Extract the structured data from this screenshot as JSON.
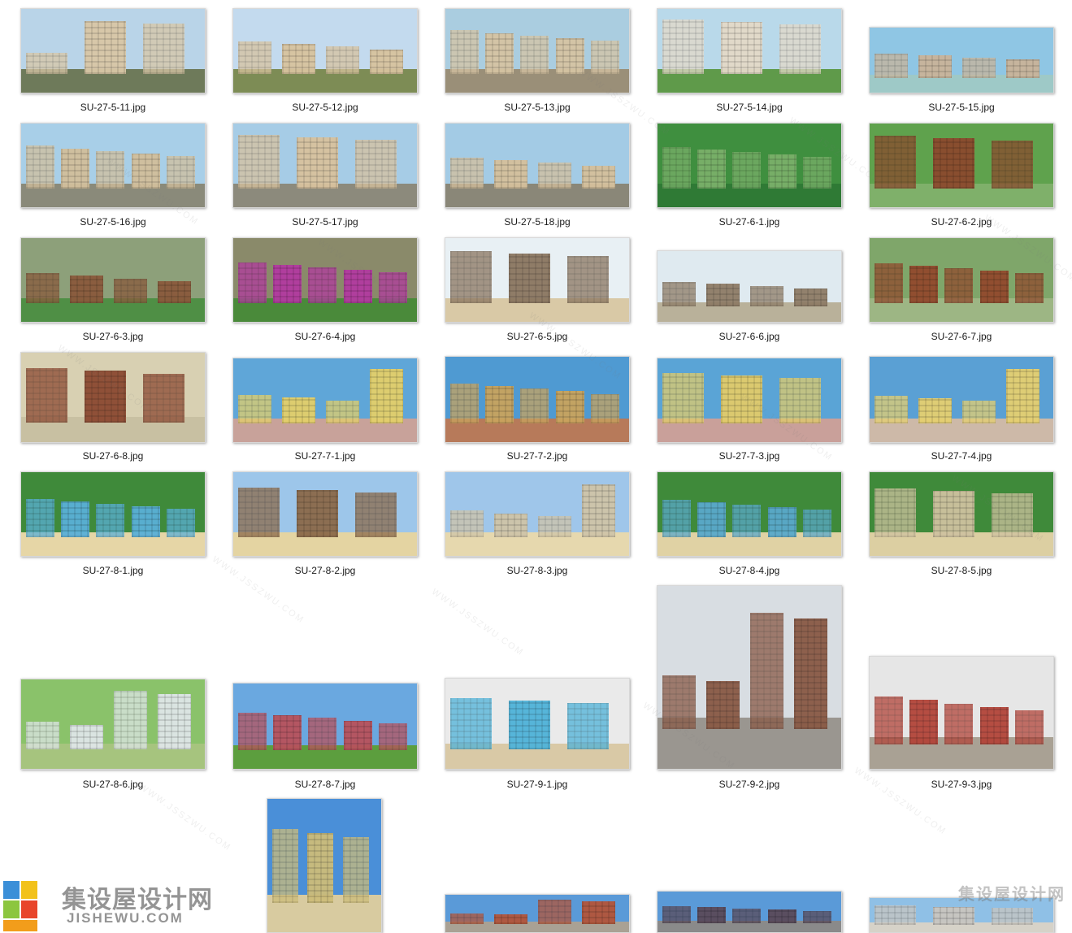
{
  "files": [
    {
      "name": "SU-27-5-11.jpg",
      "sky": "#b9d4e8",
      "ground": "#6e7a5a",
      "bld": "#d9c7a6"
    },
    {
      "name": "SU-27-5-12.jpg",
      "sky": "#c3daee",
      "ground": "#7d8c55",
      "bld": "#d8c39e"
    },
    {
      "name": "SU-27-5-13.jpg",
      "sky": "#aacde0",
      "ground": "#9a8f78",
      "bld": "#d6c4a3"
    },
    {
      "name": "SU-27-5-14.jpg",
      "sky": "#b9d9ea",
      "ground": "#5f9a4a",
      "bld": "#e4d9c8"
    },
    {
      "name": "SU-27-5-15.jpg",
      "sky": "#8fc6e4",
      "ground": "#9ec9c7",
      "bld": "#c9b49a"
    },
    {
      "name": "SU-27-5-16.jpg",
      "sky": "#a8cfe8",
      "ground": "#8a8a7a",
      "bld": "#d2bf9c"
    },
    {
      "name": "SU-27-5-17.jpg",
      "sky": "#a6cce6",
      "ground": "#8c8a7c",
      "bld": "#d8c29e"
    },
    {
      "name": "SU-27-5-18.jpg",
      "sky": "#a3cbe5",
      "ground": "#8a8778",
      "bld": "#d5c09c"
    },
    {
      "name": "SU-27-6-1.jpg",
      "sky": "#3f8f3f",
      "ground": "#2f7a35",
      "bld": "#7ab06a"
    },
    {
      "name": "SU-27-6-2.jpg",
      "sky": "#5fa24d",
      "ground": "#7fb06a",
      "bld": "#8c4a2e"
    },
    {
      "name": "SU-27-6-3.jpg",
      "sky": "#8da07a",
      "ground": "#4f8f45",
      "bld": "#8a5a3c"
    },
    {
      "name": "SU-27-6-4.jpg",
      "sky": "#8a8a6a",
      "ground": "#4a8a3a",
      "bld": "#b33aa0"
    },
    {
      "name": "SU-27-6-5.jpg",
      "sky": "#e8f0f4",
      "ground": "#d9c9a6",
      "bld": "#8b7660"
    },
    {
      "name": "SU-27-6-6.jpg",
      "sky": "#dfeaf0",
      "ground": "#b9b19a",
      "bld": "#8e7c66"
    },
    {
      "name": "SU-27-6-7.jpg",
      "sky": "#7fa66a",
      "ground": "#9db684",
      "bld": "#924a2d"
    },
    {
      "name": "SU-27-6-8.jpg",
      "sky": "#d8d0b2",
      "ground": "#c8c0a2",
      "bld": "#8c4a32"
    },
    {
      "name": "SU-27-7-1.jpg",
      "sky": "#5fa6d8",
      "ground": "#c8a29a",
      "bld": "#e4d06a"
    },
    {
      "name": "SU-27-7-2.jpg",
      "sky": "#4f9ad2",
      "ground": "#b77a5a",
      "bld": "#c9a45e"
    },
    {
      "name": "SU-27-7-3.jpg",
      "sky": "#5aa4d6",
      "ground": "#c9a09a",
      "bld": "#e2cc6a"
    },
    {
      "name": "SU-27-7-4.jpg",
      "sky": "#5aa0d4",
      "ground": "#cdb9a8",
      "bld": "#e6d070"
    },
    {
      "name": "SU-27-8-1.jpg",
      "sky": "#3f8a3a",
      "ground": "#e6d6a6",
      "bld": "#5ab0d8"
    },
    {
      "name": "SU-27-8-2.jpg",
      "sky": "#9dc6ea",
      "ground": "#e4d4a2",
      "bld": "#8c6a4a"
    },
    {
      "name": "SU-27-8-3.jpg",
      "sky": "#9fc6ea",
      "ground": "#e6d8ae",
      "bld": "#cfc4a8"
    },
    {
      "name": "SU-27-8-4.jpg",
      "sky": "#3f8a3a",
      "ground": "#e0d2a4",
      "bld": "#5aa9cc"
    },
    {
      "name": "SU-27-8-5.jpg",
      "sky": "#3f8a3a",
      "ground": "#dccfa2",
      "bld": "#cfc2a0"
    },
    {
      "name": "SU-27-8-6.jpg",
      "sky": "#8ac26a",
      "ground": "#a6c47e",
      "bld": "#dfe6e8"
    },
    {
      "name": "SU-27-8-7.jpg",
      "sky": "#6aa8e0",
      "ground": "#5c9e3e",
      "bld": "#b8525c"
    },
    {
      "name": "SU-27-9-1.jpg",
      "sky": "#eaeaea",
      "ground": "#d9c9a6",
      "bld": "#4fb3d9"
    },
    {
      "name": "SU-27-9-2.jpg",
      "sky": "#d8dde2",
      "ground": "#9a9690",
      "bld": "#8a5a46"
    },
    {
      "name": "SU-27-9-3.jpg",
      "sky": "#e6e6e6",
      "ground": "#a9a194",
      "bld": "#b3453a"
    },
    {
      "name": "",
      "sky": "#4a8fd8",
      "ground": "#d8cba0",
      "bld": "#cdbd7a"
    },
    {
      "name": "",
      "sky": "#5a9ad8",
      "ground": "#a9a194",
      "bld": "#b3553a"
    },
    {
      "name": "",
      "sky": "#5a9ad8",
      "ground": "#8a8a8a",
      "bld": "#5a4a5a"
    },
    {
      "name": "",
      "sky": "#8fc0e6",
      "ground": "#d6d2c8",
      "bld": "#c9c6c0"
    }
  ],
  "logo_left": {
    "cn": "集设屋设计网",
    "en": "JISHEWU.COM"
  },
  "logo_right": {
    "cn": "集设屋设计网"
  },
  "watermark_text": "WWW.JSSZWU.COM"
}
